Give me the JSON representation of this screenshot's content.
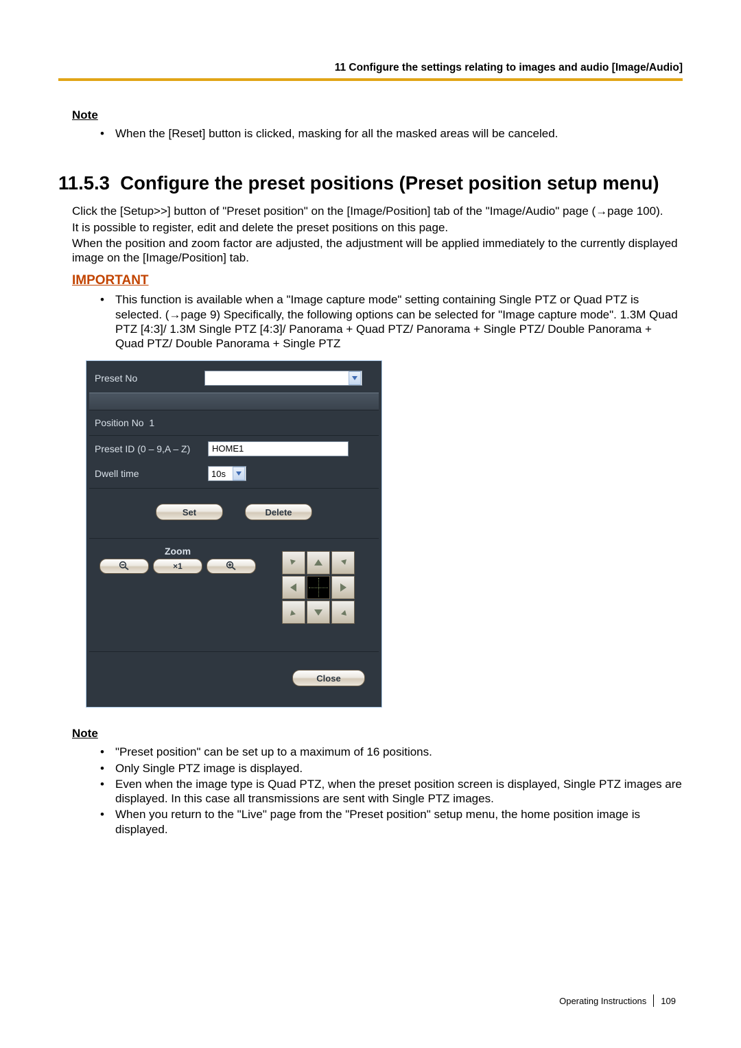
{
  "header": {
    "running_title": "11 Configure the settings relating to images and audio [Image/Audio]"
  },
  "note1": {
    "heading": "Note",
    "items": [
      "When the [Reset] button is clicked, masking for all the masked areas will be canceled."
    ]
  },
  "section": {
    "number": "11.5.3",
    "title": "Configure the preset positions (Preset position setup menu)"
  },
  "intro": {
    "p1": "Click the [Setup>>] button of \"Preset position\" on the [Image/Position] tab of the \"Image/Audio\" page (→page 100).",
    "p2": "It is possible to register, edit and delete the preset positions on this page.",
    "p3": "When the position and zoom factor are adjusted, the adjustment will be applied immediately to the currently displayed image on the [Image/Position] tab."
  },
  "important": {
    "heading": "IMPORTANT",
    "items": [
      "This function is available when a \"Image capture mode\" setting containing Single PTZ or Quad PTZ is selected. (→page 9) Specifically, the following options can be selected for \"Image capture mode\". 1.3M Quad PTZ [4:3]/ 1.3M Single PTZ [4:3]/ Panorama + Quad PTZ/ Panorama + Single PTZ/ Double Panorama + Quad PTZ/ Double Panorama + Single PTZ"
    ]
  },
  "ui": {
    "preset_no_label": "Preset No",
    "preset_no_value": "",
    "position_no_label": "Position No",
    "position_no_value": "1",
    "preset_id_label": "Preset ID (0 – 9,A – Z)",
    "preset_id_value": "HOME1",
    "dwell_label": "Dwell time",
    "dwell_value": "10s",
    "set_label": "Set",
    "delete_label": "Delete",
    "zoom_label": "Zoom",
    "zoom_x1_label": "×1",
    "close_label": "Close"
  },
  "note2": {
    "heading": "Note",
    "items": [
      "\"Preset position\" can be set up to a maximum of 16 positions.",
      "Only Single PTZ image is displayed.",
      "Even when the image type is Quad PTZ, when the preset position screen is displayed, Single PTZ images are displayed. In this case all transmissions are sent with Single PTZ images.",
      "When you return to the \"Live\" page from the \"Preset position\" setup menu, the home position image is displayed."
    ]
  },
  "footer": {
    "doc_label": "Operating Instructions",
    "page_number": "109"
  }
}
